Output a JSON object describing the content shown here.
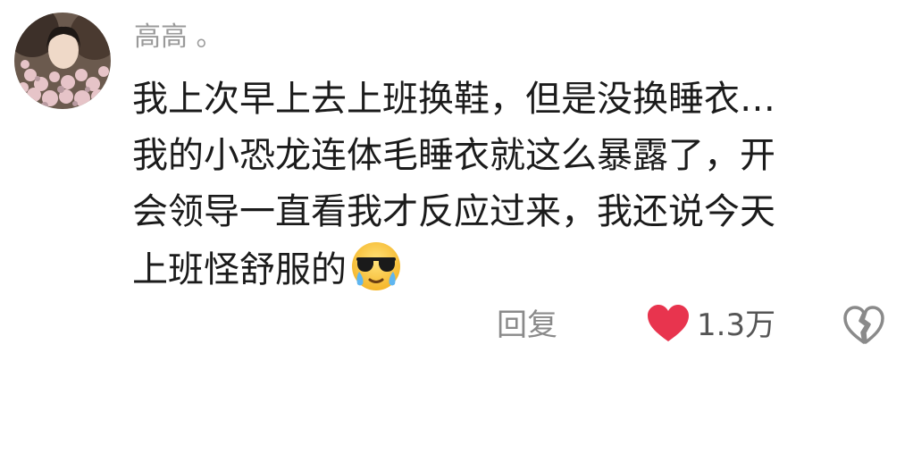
{
  "comment": {
    "username": "高高 。",
    "text_lines": [
      "我上次早上去上班换鞋，但是没换睡衣…",
      "我的小恐龙连体毛睡衣就这么暴露了，开",
      "会领导一直看我才反应过来，我还说今天",
      "上班怪舒服的"
    ],
    "emoji": "crying-sunglasses-face-emoji"
  },
  "actions": {
    "reply_label": "回复",
    "like_count": "1.3万",
    "like_icon": "heart-icon",
    "dislike_icon": "broken-heart-icon",
    "like_color": "#e8344e"
  }
}
